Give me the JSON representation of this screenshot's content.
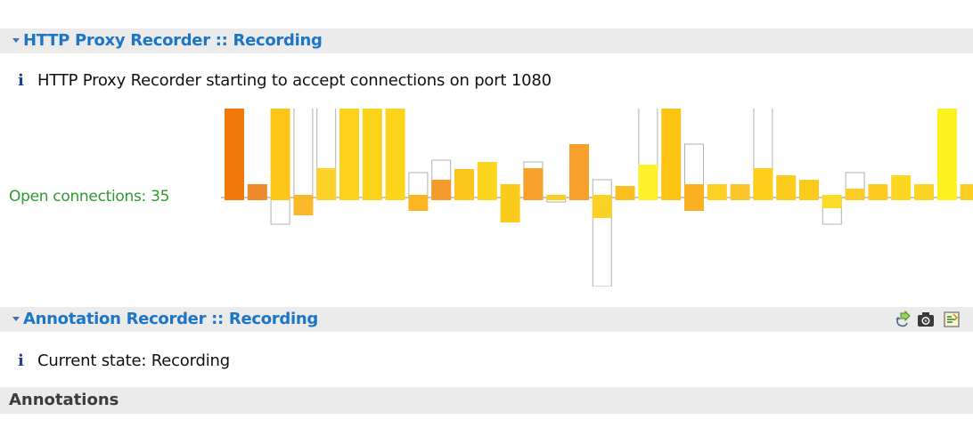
{
  "http_proxy": {
    "title": "HTTP Proxy Recorder :: Recording",
    "info_message": "HTTP Proxy Recorder starting to accept connections on port 1080",
    "open_connections_label": "Open connections: 35"
  },
  "annotation_recorder": {
    "title": "Annotation Recorder :: Recording",
    "info_message": "Current state: Recording",
    "toolbar_icons": [
      "add-annotation-icon",
      "screenshot-camera-icon",
      "annotation-settings-icon"
    ]
  },
  "annotations": {
    "title": "Annotations"
  },
  "info_glyph": "i",
  "colors": {
    "header_bg": "#ebebeb",
    "title_blue": "#1c75c5",
    "connections_green": "#2e9a2e",
    "info_icon": "#1f3f8f"
  },
  "chart_data": {
    "type": "bar",
    "description_units": "relative connection activity per time slot; up = opened, down = closed",
    "baseline": 0,
    "ylim": [
      -100,
      100
    ],
    "series": [
      {
        "name": "up_filled",
        "values": [
          103,
          15,
          103,
          3,
          33,
          103,
          103,
          103,
          3,
          20,
          32,
          40,
          15,
          33,
          3,
          60,
          3,
          13,
          37,
          103,
          15,
          15,
          15,
          33,
          25,
          20,
          3,
          10,
          15,
          25,
          15,
          103,
          15
        ]
      },
      {
        "name": "up_outline",
        "values": [
          0,
          0,
          0,
          103,
          103,
          0,
          0,
          0,
          28,
          42,
          0,
          0,
          0,
          40,
          0,
          0,
          20,
          0,
          103,
          0,
          60,
          0,
          0,
          103,
          0,
          0,
          0,
          28,
          0,
          0,
          0,
          0,
          0
        ]
      },
      {
        "name": "down_filled",
        "values": [
          3,
          3,
          3,
          20,
          3,
          3,
          3,
          3,
          15,
          3,
          3,
          3,
          28,
          3,
          3,
          3,
          23,
          3,
          3,
          3,
          15,
          3,
          3,
          3,
          3,
          3,
          12,
          3,
          3,
          3,
          3,
          3,
          3
        ]
      },
      {
        "name": "down_outline",
        "values": [
          0,
          0,
          30,
          0,
          0,
          0,
          0,
          0,
          0,
          0,
          0,
          0,
          0,
          0,
          5,
          0,
          100,
          0,
          0,
          0,
          0,
          0,
          0,
          0,
          0,
          0,
          30,
          0,
          0,
          0,
          0,
          0,
          0
        ]
      },
      {
        "name": "colors",
        "values": [
          "#f3780b",
          "#ec8a2c",
          "#fcc51a",
          "#f8b82a",
          "#fbd22a",
          "#fbd11b",
          "#fbd21a",
          "#fcd41c",
          "#fbb522",
          "#f59a2d",
          "#fbc51e",
          "#fbd51e",
          "#fbcb1c",
          "#f6a22b",
          "#fbd024",
          "#f7a02b",
          "#fbd224",
          "#fcbf20",
          "#fcf12a",
          "#fdc313",
          "#fcb122",
          "#fcd024",
          "#fbc62a",
          "#fbcf1a",
          "#fbcc1c",
          "#fbcb1e",
          "#fbdb26",
          "#fccc26",
          "#fcca20",
          "#fcd620",
          "#fcd524",
          "#fbf21f",
          "#fbcd22"
        ]
      }
    ]
  }
}
